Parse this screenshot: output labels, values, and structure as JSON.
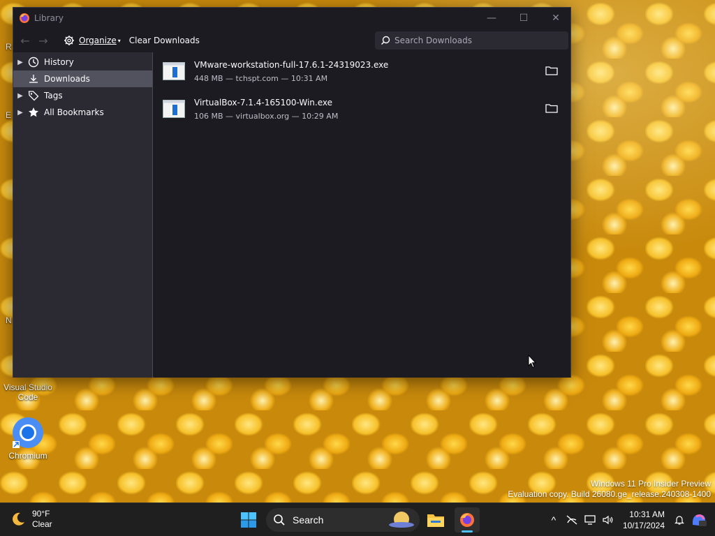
{
  "window": {
    "title": "Library",
    "controls": {
      "minimize": "—",
      "maximize": "☐",
      "close": "✕"
    }
  },
  "toolbar": {
    "back": "←",
    "forward": "→",
    "organize_label": "Organize",
    "organize_caret": "▾",
    "clear_label": "Clear Downloads",
    "search_placeholder": "Search Downloads"
  },
  "sidebar": {
    "items": [
      {
        "label": "History",
        "icon": "clock-icon",
        "expandable": true
      },
      {
        "label": "Downloads",
        "icon": "download-icon",
        "expandable": false,
        "selected": true
      },
      {
        "label": "Tags",
        "icon": "tag-icon",
        "expandable": true
      },
      {
        "label": "All Bookmarks",
        "icon": "star-icon",
        "expandable": true
      }
    ]
  },
  "downloads": [
    {
      "name": "VMware-workstation-full-17.6.1-24319023.exe",
      "meta": "448 MB — tchspt.com — 10:31 AM"
    },
    {
      "name": "VirtualBox-7.1.4-165100-Win.exe",
      "meta": "106 MB — virtualbox.org — 10:29 AM"
    }
  ],
  "desktop": {
    "vscode_label_1": "Visual Studio",
    "vscode_label_2": "Code",
    "chromium_label": "Chromium",
    "edge_r": "R",
    "edge_e": "E",
    "edge_n": "N"
  },
  "watermark": {
    "line1": "Windows 11 Pro Insider Preview",
    "line2": "Evaluation copy. Build 26080.ge_release.240308-1400"
  },
  "taskbar": {
    "temp": "90°F",
    "condition": "Clear",
    "search_label": "Search",
    "time": "10:31 AM",
    "date": "10/17/2024",
    "tray_chevron": "^"
  },
  "colors": {
    "window_bg": "#1c1b22",
    "sidebar_bg": "#2b2a33",
    "selected_bg": "#52525e",
    "accent_blue": "#0078d4"
  }
}
